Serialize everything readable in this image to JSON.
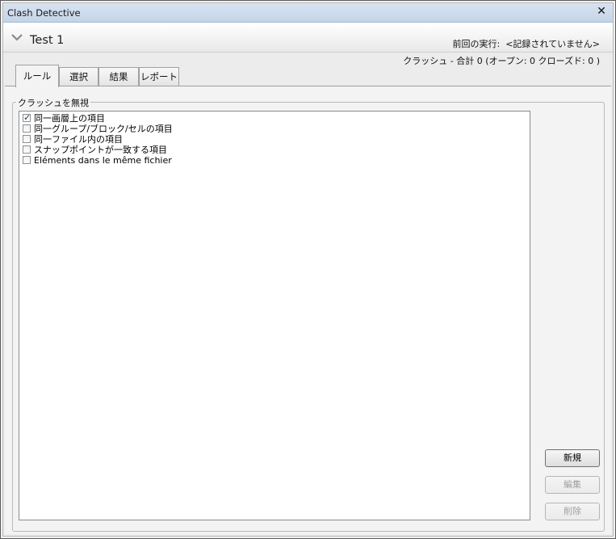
{
  "window": {
    "title": "Clash Detective",
    "close_glyph": "✕"
  },
  "test": {
    "name": "Test 1",
    "last_run_label": "前回の実行:",
    "last_run_value": "<記録されていません>",
    "clash_summary": "クラッシュ -  合計  0  (オープン:  0  クローズド:  0 )"
  },
  "tabs": [
    {
      "label": "ルール",
      "active": true
    },
    {
      "label": "選択",
      "active": false
    },
    {
      "label": "結果",
      "active": false
    },
    {
      "label": "レポート",
      "active": false
    }
  ],
  "ignore_group": {
    "legend": "クラッシュを無視",
    "items": [
      {
        "label": "同一画層上の項目",
        "checked": true
      },
      {
        "label": "同一グループ/ブロック/セルの項目",
        "checked": false
      },
      {
        "label": "同一ファイル内の項目",
        "checked": false
      },
      {
        "label": "スナップポイントが一致する項目",
        "checked": false
      },
      {
        "label": "Eléments dans le même fichier",
        "checked": false
      }
    ]
  },
  "buttons": {
    "new": {
      "label": "新規",
      "enabled": true
    },
    "edit": {
      "label": "編集",
      "enabled": false
    },
    "delete": {
      "label": "削除",
      "enabled": false
    }
  },
  "icons": {
    "collapse": "chevron-down-icon",
    "check": "checkmark-icon"
  }
}
